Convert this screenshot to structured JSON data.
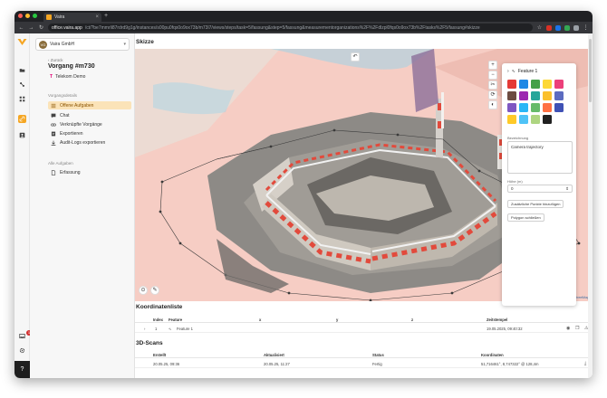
{
  "browser": {
    "tab_title": "Vaira",
    "url_host": "office.vaira.app",
    "url_path": "/ct/?be7mmrli87rdrd9g1g/instances/s00pu0fqs0o9ox73b/m73l7/views/steps/task=5/fassung&step=5/fassung&measurementorganizations%2F%2Fdlzpl0fqs0o9ox73b%2Ftasks%2F5/fassung#skizze"
  },
  "sidebar": {
    "company_initials": "VG",
    "company_name": "Vaira GmbH",
    "back_label": "Zurück",
    "case_title": "Vorgang #m730",
    "case_subtitle": "Telekom Demo",
    "section_process": "Vorgangsdetails",
    "section_all": "Alle Aufgaben",
    "items": [
      {
        "label": "Offene Aufgaben",
        "icon": "list-icon"
      },
      {
        "label": "Chat",
        "icon": "chat-icon"
      },
      {
        "label": "Verknüpfte Vorgänge",
        "icon": "link-icon"
      },
      {
        "label": "Exportieren",
        "icon": "export-icon"
      },
      {
        "label": "Audit-Logs exportieren",
        "icon": "download-icon"
      }
    ],
    "all_items": [
      {
        "label": "Erfassung",
        "icon": "document-icon"
      }
    ],
    "notification_count": "1"
  },
  "main": {
    "sketch_title": "Skizze",
    "attribution": "Kartendaten © OpenStreetMap",
    "panel": {
      "feature_name": "Feature 1",
      "colors": [
        "#e53935",
        "#1e88e5",
        "#43a047",
        "#fdd835",
        "#ec407a",
        "#6d4c41",
        "#9c27b0",
        "#26a69a",
        "#fbc02d",
        "#5c6bc0",
        "#7e57c2",
        "#29b6f6",
        "#66bb6a",
        "#ff7043",
        "#3f51b5",
        "#ffca28",
        "#4fc3f7",
        "#aed581",
        "#212121"
      ],
      "label_description": "Bezeichnung",
      "description_value": "Camera trajectory",
      "label_height": "Höhe (m)",
      "height_value": "0",
      "btn_add_points": "Zusätzliche Punkte hinzufügen",
      "btn_close_polygon": "Polygon schließen"
    },
    "coords": {
      "title": "Koordinatenliste",
      "headers": [
        "Index",
        "Feature",
        "x",
        "y",
        "z",
        "Zeitstempel"
      ],
      "rows": [
        {
          "index": "1",
          "feature": "Feature 1",
          "x": "",
          "y": "",
          "z": "",
          "timestamp": "19.05.2025, 09:40:32"
        }
      ]
    },
    "scans": {
      "title": "3D-Scans",
      "headers": [
        "Erstellt",
        "Aktualisiert",
        "Status",
        "Koordinaten"
      ],
      "rows": [
        {
          "created": "20.05.25, 09:36",
          "updated": "20.05.25, 11:27",
          "status": "Fertig",
          "coords": "51,716461°, 8,747322° @ 128,4m"
        }
      ]
    }
  },
  "colors": {
    "accent": "#f5a623",
    "accent_light": "#fbe3b8"
  }
}
